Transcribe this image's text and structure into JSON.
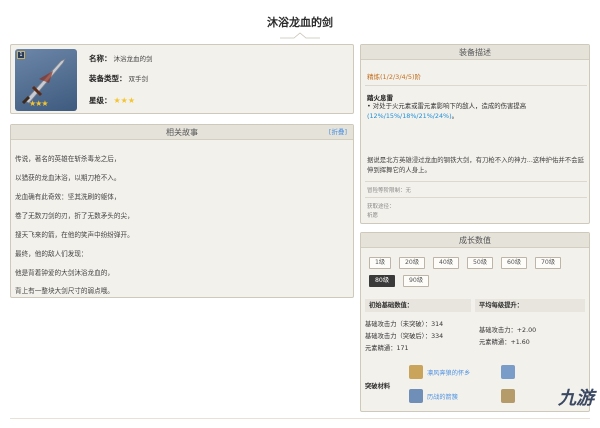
{
  "page": {
    "title": "沐浴龙血的剑"
  },
  "info": {
    "thumb_badge": "1",
    "name_label": "名称：",
    "name_value": "沐浴龙血的剑",
    "type_label": "装备类型：",
    "type_value": "双手剑",
    "rarity_label": "星级：",
    "rarity_stars": "★★★",
    "thumb_stars": "★★★"
  },
  "story": {
    "title": "相关故事",
    "fold_label": "[折叠]",
    "lines": [
      "传说，著名的英雄在斩杀毒龙之后，",
      "以猎获的龙血沐浴，以期刀枪不入。",
      "龙血确有此奇效：坚其洗刷的躯体，",
      "卷了无数刀剑的刃，折了无数矛头的尖，",
      "搜天飞来的箭，在他的笑声中纷纷弹开。",
      "最终，他的敌人们发现：",
      "他是背着钟爱的大剑沐浴龙血的，",
      "背上有一整块大剑尺寸的弱点哦。"
    ]
  },
  "equip": {
    "title": "装备描述",
    "refine": "精炼(1/2/3/4/5)阶",
    "skill_title": "踏火息雷",
    "skill_desc_prefix": "• 对处于火元素或雷元素影响下的敌人，造成的伤害提高",
    "skill_desc_highlight": "(12%/15%/18%/21%/24%)",
    "skill_desc_suffix": "。",
    "lore": "据说是北方英雄浸过龙血的钢铁大剑，有刀枪不入的神力...这种护佑并不会延伸到挥舞它的人身上。",
    "limit": "冒险等阶限制：无",
    "source_label": "获取途径：",
    "source_value": "祈愿"
  },
  "growth": {
    "title": "成长数值",
    "levels": [
      "1级",
      "20级",
      "40级",
      "50级",
      "60级",
      "70级",
      "80级",
      "90级"
    ],
    "active_level": "80级",
    "base_head": "初始基础数值：",
    "avg_head": "平均每级提升：",
    "base_lines": [
      "基础攻击力（未突破）：314",
      "基础攻击力（突破后）：334",
      "元素精通：171"
    ],
    "avg_lines": [
      "基础攻击力：+2.00",
      "元素精通：+1.60"
    ],
    "material_label": "突破材料",
    "materials": [
      "凛风奔狼的怀乡",
      "",
      "历战的箭簇",
      ""
    ]
  },
  "watermark": "九游"
}
